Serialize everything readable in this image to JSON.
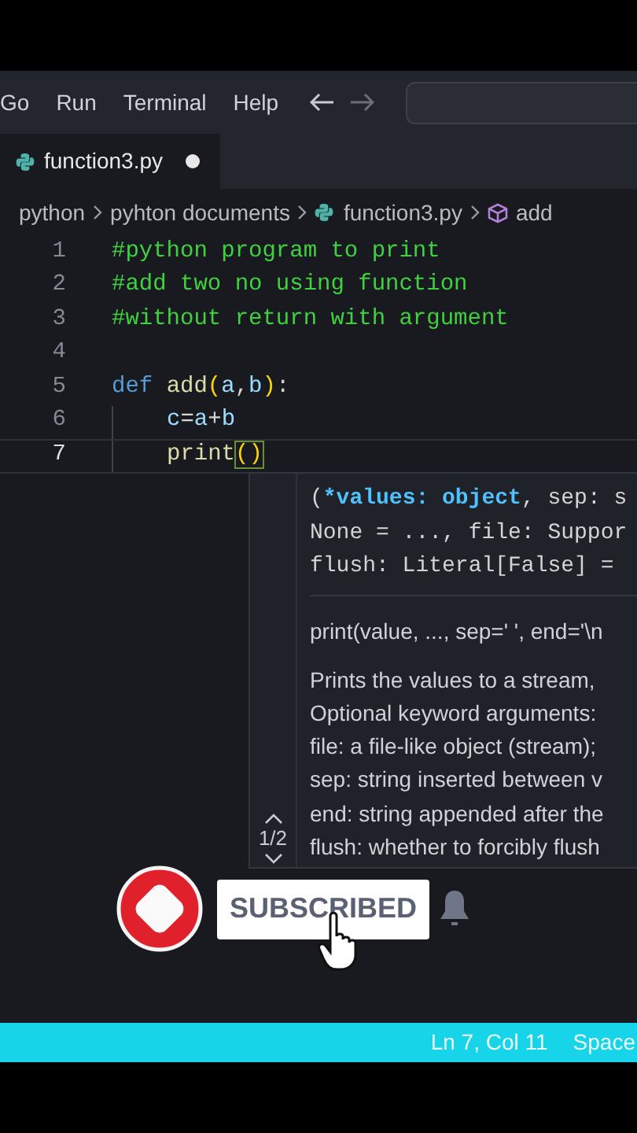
{
  "menu": [
    {
      "label": "Go"
    },
    {
      "label": "Run"
    },
    {
      "label": "Terminal"
    },
    {
      "label": "Help"
    }
  ],
  "tabs": [
    {
      "label": "function3.py",
      "selected": true,
      "modified": true
    }
  ],
  "breadcrumbs": [
    {
      "label": "python",
      "kind": "folder"
    },
    {
      "label": "pyhton documents",
      "kind": "folder"
    },
    {
      "label": "function3.py",
      "kind": "file"
    },
    {
      "label": "add",
      "kind": "symbol"
    }
  ],
  "editor": {
    "lines": [
      {
        "number": "1",
        "selected": false,
        "indent": false,
        "tokens": [
          {
            "text": "#python program to print",
            "kind": "comment"
          }
        ]
      },
      {
        "number": "2",
        "selected": false,
        "indent": false,
        "tokens": [
          {
            "text": "#add two no using function",
            "kind": "comment"
          }
        ]
      },
      {
        "number": "3",
        "selected": false,
        "indent": false,
        "tokens": [
          {
            "text": "#without return with argument",
            "kind": "comment"
          }
        ]
      },
      {
        "number": "4",
        "selected": false,
        "indent": false
      },
      {
        "number": "5",
        "selected": false,
        "indent": false,
        "tokens": [
          {
            "text": "def ",
            "kind": "keyword"
          },
          {
            "text": "add",
            "kind": "function"
          },
          {
            "text": "(",
            "kind": "bracket"
          },
          {
            "text": "a",
            "kind": "variable"
          },
          {
            "text": ",",
            "kind": "plain"
          },
          {
            "text": "b",
            "kind": "variable"
          },
          {
            "text": ")",
            "kind": "bracket"
          },
          {
            "text": ":",
            "kind": "plain"
          }
        ]
      },
      {
        "number": "6",
        "selected": false,
        "indent": true,
        "tokens": [
          {
            "text": "c",
            "kind": "variable"
          },
          {
            "text": "=",
            "kind": "plain"
          },
          {
            "text": "a",
            "kind": "variable"
          },
          {
            "text": "+",
            "kind": "plain"
          },
          {
            "text": "b",
            "kind": "variable"
          }
        ]
      },
      {
        "number": "7",
        "selected": true,
        "indent": true,
        "tokens": [
          {
            "text": "print",
            "kind": "function"
          },
          {
            "text": "()",
            "kind": "matched"
          }
        ]
      }
    ]
  },
  "hover": {
    "signature": [
      [
        {
          "text": "(",
          "kind": "plain"
        },
        {
          "text": "*values: object",
          "kind": "param"
        },
        {
          "text": ", sep: s",
          "kind": "plain"
        }
      ],
      [
        {
          "text": "None = ..., file: Suppor",
          "kind": "plain"
        }
      ],
      [
        {
          "text": "flush: Literal[False] =",
          "kind": "plain"
        }
      ]
    ],
    "call": "print(value, ..., sep=' ', end='\\n",
    "doc": [
      "Prints the values to a stream,",
      "Optional keyword arguments:",
      "file: a file-like object (stream);",
      "sep: string inserted between v",
      "end: string appended after the",
      "flush: whether to forcibly flush"
    ],
    "pager": "1/2"
  },
  "subscribe": {
    "label": "SUBSCRIBED"
  },
  "status_bar": [
    {
      "label": "Ln 7, Col 11"
    },
    {
      "label": "Space"
    }
  ]
}
